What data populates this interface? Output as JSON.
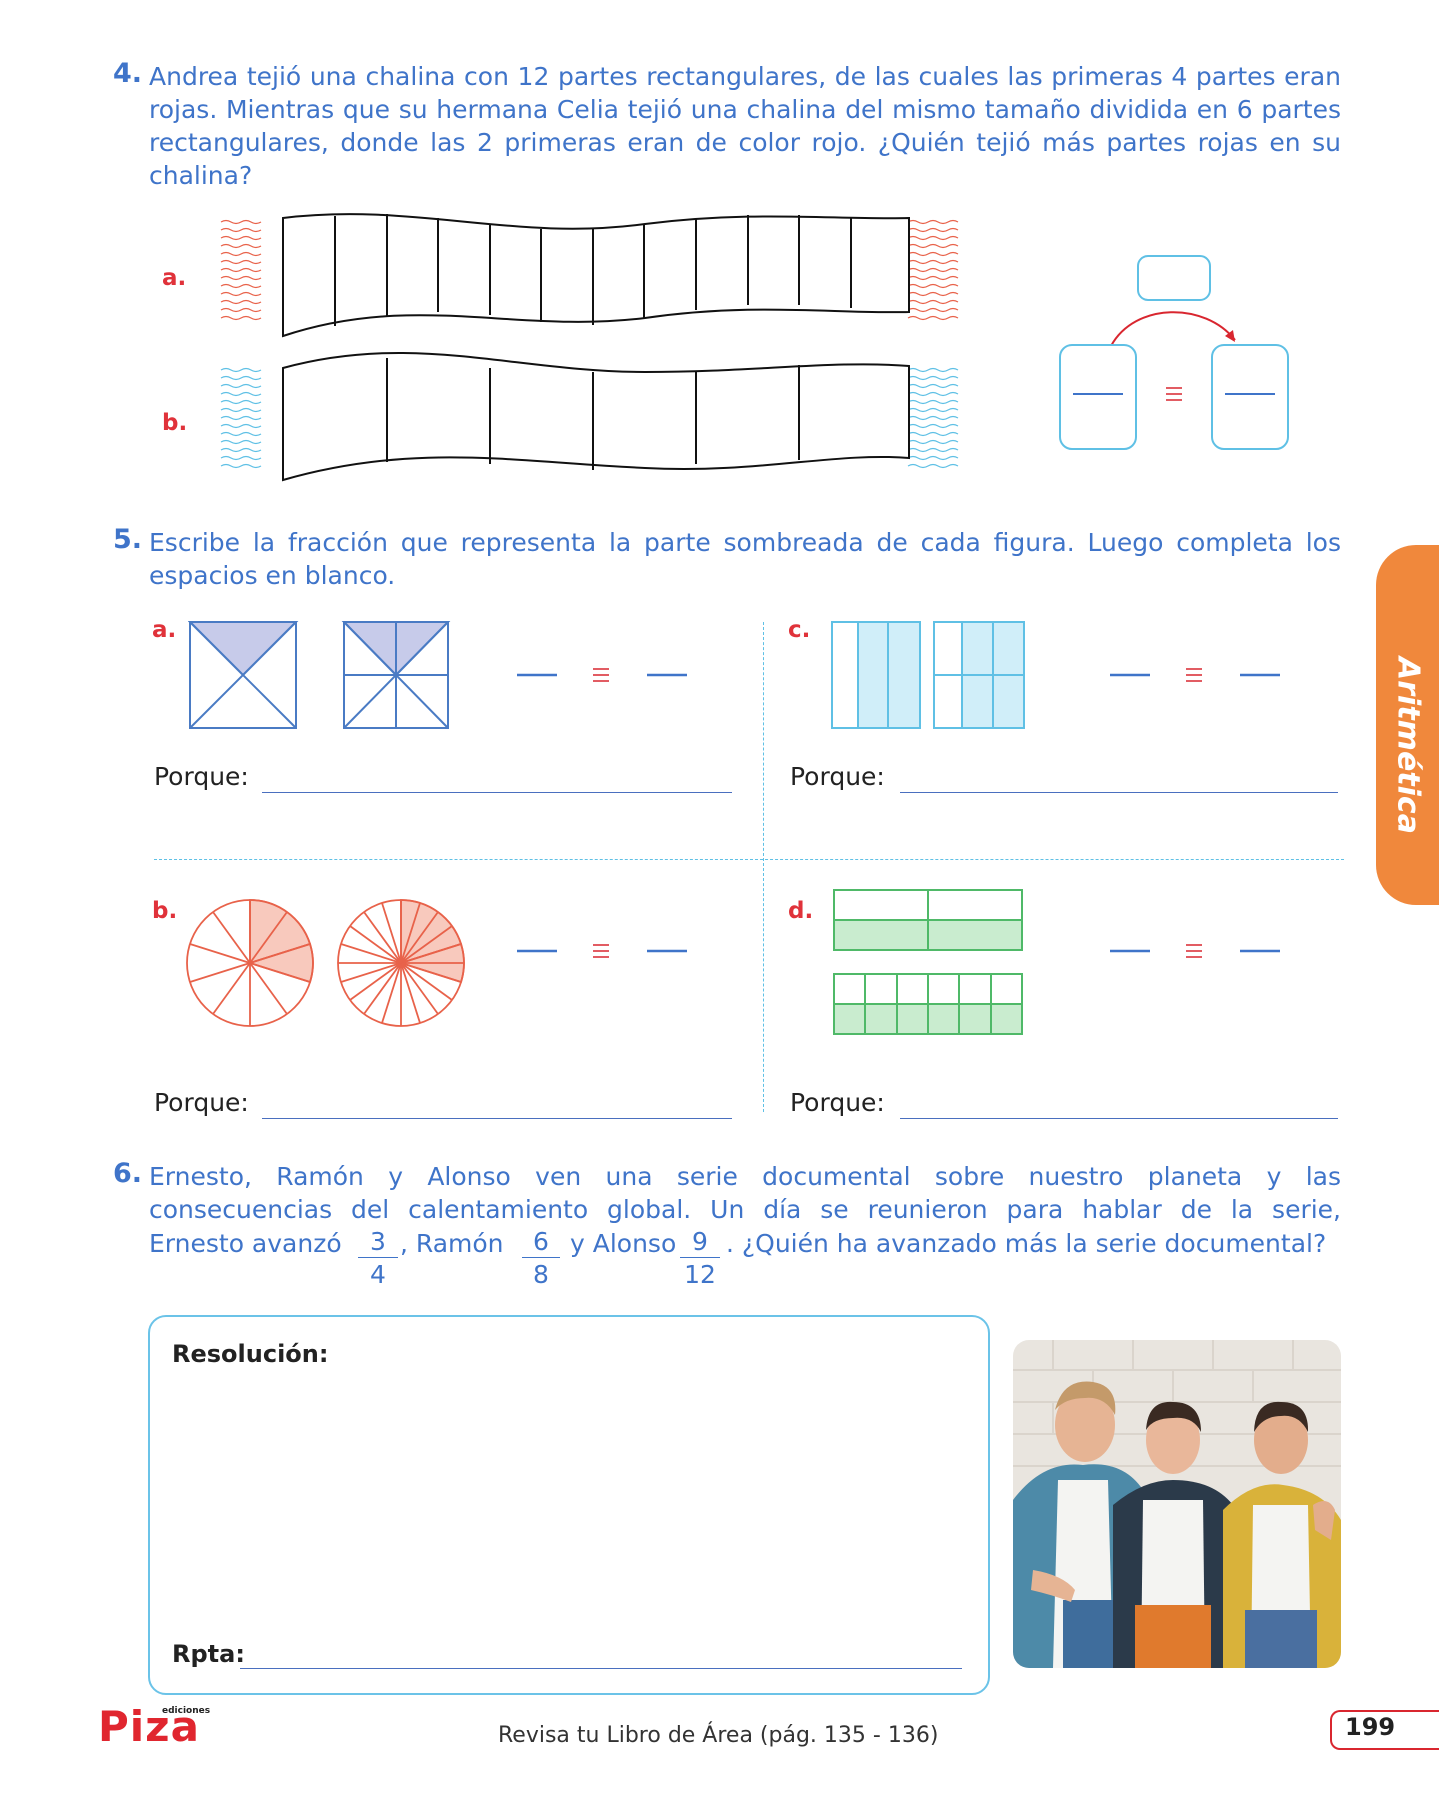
{
  "q4": {
    "number": "4.",
    "text": "Andrea tejió una chalina con 12 partes rectangulares, de las cuales las primeras 4 partes eran rojas. Mientras que su hermana Celia tejió una chalina del mismo tamaño dividida en 6 partes rectangulares, donde las 2 primeras eran de color rojo. ¿Quién tejió más partes rojas en su chalina?",
    "label_a": "a.",
    "label_b": "b.",
    "scarf_a_parts": 12,
    "scarf_b_parts": 6
  },
  "q5": {
    "number": "5.",
    "text": "Escribe la fracción que representa la parte sombreada de cada figura. Luego completa los espacios en blanco.",
    "items": [
      {
        "label": "a.",
        "porque": "Porque:"
      },
      {
        "label": "b.",
        "porque": "Porque:"
      },
      {
        "label": "c.",
        "porque": "Porque:"
      },
      {
        "label": "d.",
        "porque": "Porque:"
      }
    ]
  },
  "q6": {
    "number": "6.",
    "line1": "Ernesto, Ramón y Alonso ven una serie documental sobre nuestro planeta y las",
    "line2": "consecuencias del calentamiento global. Un día se reunieron para hablar de la serie,",
    "line3_a": "Ernesto avanzó",
    "line3_b": ", Ramón",
    "line3_c": "y Alonso",
    "line3_d": ". ¿Quién ha avanzado más la serie documental?",
    "frac1_num": "3",
    "frac1_den": "4",
    "frac2_num": "6",
    "frac2_den": "8",
    "frac3_num": "9",
    "frac3_den": "12",
    "resolution_label": "Resolución:",
    "answer_label": "Rpta:"
  },
  "side_tab": "Aritmética",
  "footer": {
    "review": "Revisa tu Libro de Área (pág. 135 - 136)",
    "page": "199",
    "logo": "Piza",
    "logo_small": "ediciones"
  },
  "colors": {
    "text_blue": "#3f74c9",
    "label_red": "#e0323a",
    "side_tab": "#f0883c",
    "figure_blue": "#4a7bc4",
    "figure_cyan": "#5fc0e5",
    "figure_red": "#e8624a",
    "figure_green": "#4fb968"
  }
}
